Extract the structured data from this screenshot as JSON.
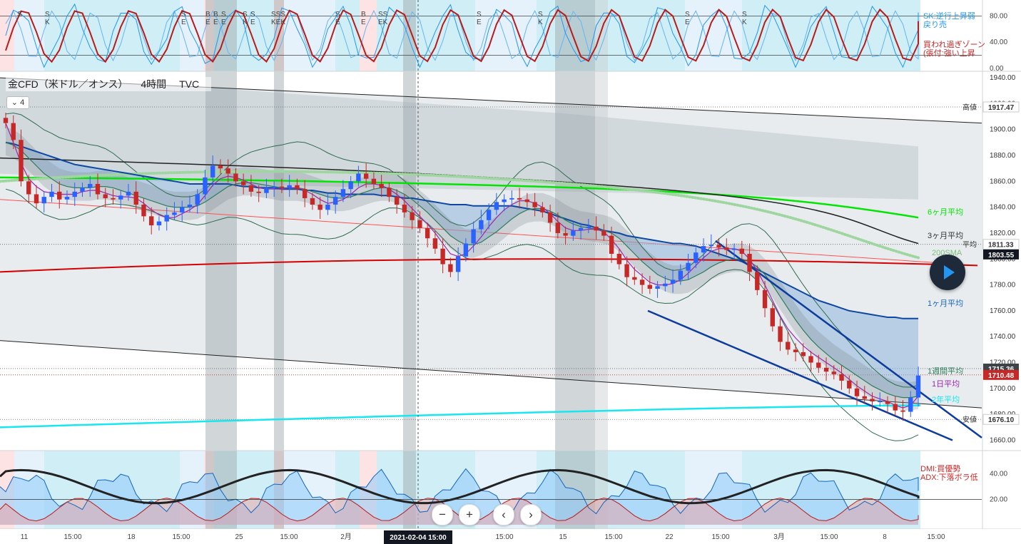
{
  "header": {
    "symbol": "金CFD（米ドル／オンス）",
    "interval": "4時間",
    "source": "TVC",
    "collapse_label": "⌄ 4"
  },
  "navigation": {
    "zoom_out": "−",
    "zoom_in": "+",
    "scroll_left": "‹",
    "scroll_right": "›"
  },
  "colors": {
    "up_candle": "#2962ff",
    "down_candle": "#c62828",
    "ma_6m": "#00e600",
    "ma_3m": "#222222",
    "ma_1m": "#0d47a1",
    "ma_1w": "#2e7d5b",
    "ma_1d": "#9c27b0",
    "ma_2y": "#18e6f0",
    "sma200": "#9fd6a0",
    "regression": "#ff5252",
    "long_trend": "#d50000",
    "bollinger": "#2e6b4e",
    "stoch_k": "#2196f3",
    "stoch_d": "#b71c1c",
    "dmi_plus": "#1565c0",
    "dmi_minus": "#b71c1c",
    "adx": "#222222",
    "adx_rising": "#00897b"
  },
  "chart_data": [
    {
      "id": "stochastic",
      "type": "line",
      "y_ticks": [
        "80.00",
        "40.00",
        "0.00"
      ],
      "ylim": [
        0,
        100
      ],
      "legend": [
        "SK:逆行上昇弱",
        "戻り売",
        "買われ過ぎゾーン",
        "(張付:強い上昇"
      ],
      "signal_labels": [
        {
          "x": 24,
          "text": "S"
        },
        {
          "x": 63,
          "text": "S\nK"
        },
        {
          "x": 254,
          "text": "S\nE"
        },
        {
          "x": 288,
          "text": "B\nE"
        },
        {
          "x": 299,
          "text": "B\nE"
        },
        {
          "x": 310,
          "text": "S\nE"
        },
        {
          "x": 340,
          "text": "S\nK"
        },
        {
          "x": 351,
          "text": "S\nE"
        },
        {
          "x": 380,
          "text": "SSS\nKEK"
        },
        {
          "x": 470,
          "text": "S\nE"
        },
        {
          "x": 506,
          "text": "B\nE"
        },
        {
          "x": 530,
          "text": "SS\nEK"
        },
        {
          "x": 668,
          "text": "S\nE"
        },
        {
          "x": 754,
          "text": "S\nK"
        },
        {
          "x": 960,
          "text": "S\nE"
        },
        {
          "x": 1040,
          "text": "S\nK"
        }
      ]
    },
    {
      "id": "price",
      "type": "line",
      "ylim": [
        1652,
        1945
      ],
      "y_ticks": [
        "1940.00",
        "1920.00",
        "1900.00",
        "1880.00",
        "1860.00",
        "1840.00",
        "1820.00",
        "1800.00",
        "1780.00",
        "1760.00",
        "1740.00",
        "1720.00",
        "1700.00",
        "1680.00",
        "1660.00"
      ],
      "x_ticks": [
        "11",
        "15:00",
        "18",
        "15:00",
        "25",
        "15:00",
        "2月",
        "15:00",
        "8",
        "15:00",
        "15",
        "15:00",
        "22",
        "15:00",
        "3月",
        "15:00",
        "8",
        "15:00"
      ],
      "crosshair_time": "2021-02-04  15:00",
      "price_labels": [
        {
          "name": "high",
          "label": "高値",
          "value": "1917.47"
        },
        {
          "name": "avg",
          "label": "平均",
          "value": "1811.33"
        },
        {
          "name": "sma",
          "label": "",
          "value": "1803.55"
        },
        {
          "name": "week",
          "label": "",
          "value": "1715.36"
        },
        {
          "name": "last",
          "label": "",
          "value": "1710.48"
        },
        {
          "name": "low",
          "label": "安値",
          "value": "1676.10"
        }
      ],
      "series_labels": [
        "6ヶ月平均",
        "3ヶ月平均",
        "200SMA",
        "1ヶ月平均",
        "1週間平均",
        "1日平均",
        "2年平均"
      ],
      "closes": [
        1905,
        1892,
        1860,
        1850,
        1843,
        1848,
        1852,
        1846,
        1848,
        1852,
        1855,
        1858,
        1850,
        1847,
        1846,
        1849,
        1852,
        1842,
        1833,
        1826,
        1829,
        1834,
        1836,
        1840,
        1842,
        1850,
        1863,
        1872,
        1870,
        1866,
        1860,
        1857,
        1852,
        1851,
        1855,
        1856,
        1855,
        1857,
        1854,
        1847,
        1842,
        1838,
        1842,
        1848,
        1854,
        1860,
        1866,
        1862,
        1858,
        1855,
        1848,
        1842,
        1836,
        1830,
        1824,
        1816,
        1808,
        1796,
        1790,
        1802,
        1812,
        1823,
        1830,
        1838,
        1844,
        1846,
        1847,
        1846,
        1844,
        1840,
        1836,
        1828,
        1820,
        1818,
        1822,
        1824,
        1825,
        1822,
        1818,
        1804,
        1796,
        1786,
        1784,
        1780,
        1777,
        1779,
        1781,
        1784,
        1791,
        1797,
        1805,
        1810,
        1811,
        1809,
        1807,
        1808,
        1804,
        1790,
        1776,
        1762,
        1748,
        1736,
        1730,
        1728,
        1725,
        1720,
        1716,
        1713,
        1711,
        1706,
        1700,
        1694,
        1692,
        1690,
        1690,
        1688,
        1683,
        1682,
        1693,
        1710
      ],
      "ma_1d": [
        1905,
        1890,
        1874,
        1862,
        1856,
        1852,
        1851,
        1850,
        1850,
        1850,
        1852,
        1853,
        1853,
        1851,
        1849,
        1848,
        1848,
        1847,
        1843,
        1838,
        1834,
        1832,
        1832,
        1835,
        1838,
        1842,
        1849,
        1857,
        1862,
        1864,
        1863,
        1861,
        1858,
        1855,
        1854,
        1854,
        1854,
        1855,
        1855,
        1853,
        1850,
        1846,
        1843,
        1844,
        1846,
        1850,
        1855,
        1858,
        1858,
        1857,
        1854,
        1850,
        1845,
        1839,
        1833,
        1827,
        1820,
        1812,
        1804,
        1802,
        1804,
        1810,
        1817,
        1825,
        1832,
        1838,
        1842,
        1845,
        1845,
        1843,
        1840,
        1835,
        1829,
        1824,
        1822,
        1822,
        1823,
        1823,
        1821,
        1815,
        1808,
        1799,
        1792,
        1787,
        1782,
        1780,
        1780,
        1781,
        1784,
        1789,
        1795,
        1801,
        1806,
        1808,
        1808,
        1808,
        1806,
        1800,
        1791,
        1780,
        1768,
        1756,
        1746,
        1739,
        1733,
        1728,
        1724,
        1720,
        1716,
        1712,
        1707,
        1702,
        1698,
        1694,
        1692,
        1690,
        1687,
        1685,
        1687,
        1694
      ],
      "ma_1w": [
        1890,
        1888,
        1884,
        1878,
        1872,
        1866,
        1862,
        1858,
        1856,
        1855,
        1855,
        1855,
        1856,
        1856,
        1855,
        1853,
        1851,
        1849,
        1847,
        1845,
        1843,
        1841,
        1840,
        1840,
        1840,
        1841,
        1844,
        1848,
        1852,
        1856,
        1858,
        1859,
        1859,
        1858,
        1857,
        1856,
        1855,
        1855,
        1855,
        1854,
        1852,
        1850,
        1848,
        1847,
        1847,
        1848,
        1850,
        1852,
        1854,
        1855,
        1855,
        1853,
        1850,
        1846,
        1841,
        1836,
        1830,
        1824,
        1818,
        1814,
        1811,
        1811,
        1813,
        1817,
        1821,
        1826,
        1831,
        1835,
        1838,
        1839,
        1839,
        1837,
        1834,
        1830,
        1827,
        1825,
        1824,
        1823,
        1822,
        1820,
        1816,
        1810,
        1804,
        1798,
        1793,
        1788,
        1785,
        1783,
        1783,
        1784,
        1787,
        1790,
        1794,
        1797,
        1799,
        1800,
        1800,
        1798,
        1794,
        1788,
        1780,
        1771,
        1762,
        1753,
        1745,
        1738,
        1732,
        1727,
        1722,
        1718,
        1714,
        1710,
        1706,
        1702,
        1699,
        1696,
        1694,
        1693,
        1693,
        1694
      ],
      "ma_1m": [
        1890,
        1889,
        1887,
        1885,
        1883,
        1881,
        1879,
        1877,
        1875,
        1873,
        1872,
        1871,
        1870,
        1869,
        1868,
        1867,
        1866,
        1865,
        1864,
        1863,
        1862,
        1861,
        1860,
        1859,
        1858,
        1858,
        1858,
        1858,
        1858,
        1858,
        1857,
        1856,
        1856,
        1855,
        1855,
        1855,
        1854,
        1854,
        1854,
        1853,
        1853,
        1852,
        1851,
        1851,
        1850,
        1850,
        1850,
        1850,
        1850,
        1849,
        1849,
        1848,
        1847,
        1847,
        1846,
        1845,
        1844,
        1843,
        1842,
        1842,
        1842,
        1841,
        1841,
        1841,
        1841,
        1841,
        1841,
        1840,
        1839,
        1838,
        1837,
        1835,
        1833,
        1831,
        1829,
        1827,
        1826,
        1824,
        1822,
        1821,
        1820,
        1818,
        1817,
        1816,
        1815,
        1814,
        1813,
        1812,
        1812,
        1811,
        1810,
        1808,
        1806,
        1804,
        1802,
        1800,
        1798,
        1795,
        1792,
        1789,
        1786,
        1783,
        1780,
        1777,
        1774,
        1771,
        1768,
        1766,
        1764,
        1762,
        1760,
        1759,
        1758,
        1757,
        1756,
        1755,
        1755,
        1754,
        1754,
        1754
      ]
    },
    {
      "id": "dmi",
      "type": "area",
      "y_ticks": [
        "40.00",
        "20.00"
      ],
      "ylim": [
        0,
        55
      ],
      "legend": [
        "DMI:買優勢",
        "ADX:下落ボラ低"
      ]
    }
  ]
}
